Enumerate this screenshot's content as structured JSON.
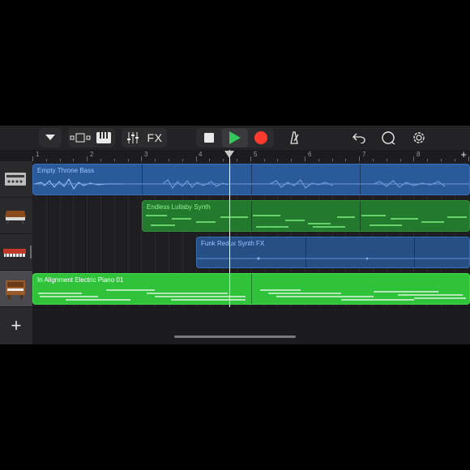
{
  "toolbar": {
    "fx_label": "FX",
    "buttons": [
      "browser-dropdown",
      "tracks-view",
      "keyboard",
      "mixer",
      "fx",
      "stop",
      "play",
      "record",
      "metronome",
      "undo",
      "loop-browser",
      "settings"
    ]
  },
  "ruler": {
    "bars": [
      "1",
      "2",
      "3",
      "4",
      "5",
      "6",
      "7",
      "8"
    ]
  },
  "tracks": [
    {
      "name": "Empty Throne Bass",
      "instrument": "bass-amp-icon",
      "color": "blue"
    },
    {
      "name": "Endless Lullaby Synth",
      "instrument": "analog-synth-icon",
      "color": "green"
    },
    {
      "name": "Funk Redux Synth FX",
      "instrument": "red-synth-icon",
      "color": "blue"
    },
    {
      "name": "In Alignment Electric Piano 01",
      "instrument": "electric-piano-icon",
      "color": "bright-green"
    }
  ],
  "add_track_symbol": "+",
  "colors": {
    "audio_blue": "#2a5a9a",
    "synth_green": "#237a2e",
    "selected_green": "#2fc23a",
    "record_red": "#ff3b30",
    "play_green": "#34c759"
  }
}
